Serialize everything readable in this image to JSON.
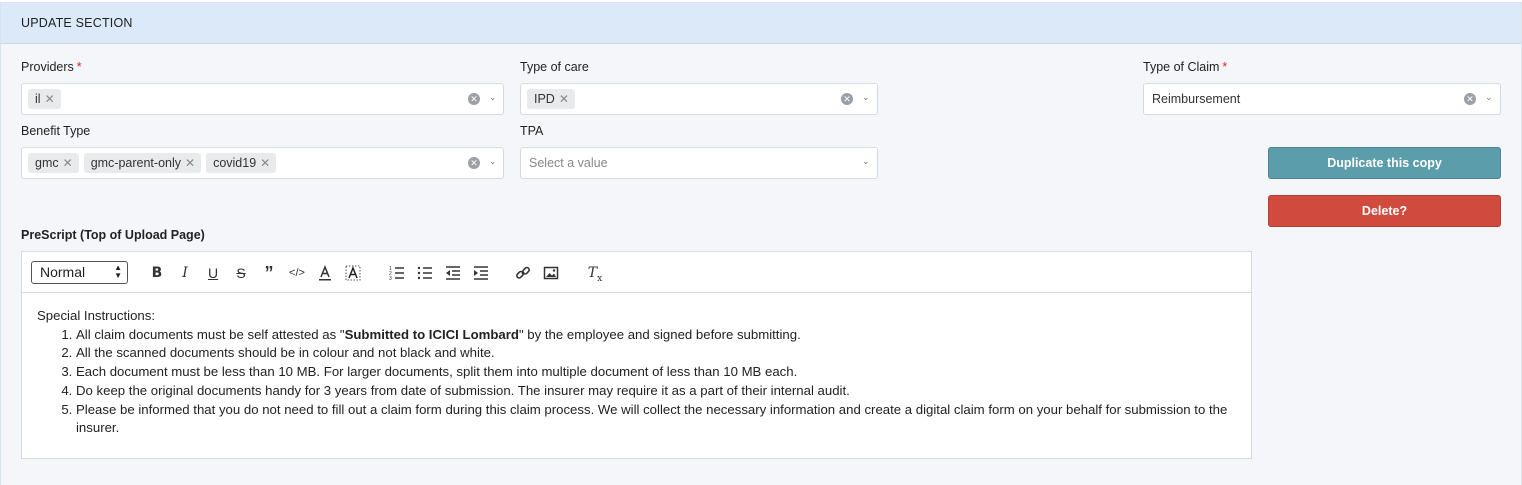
{
  "header": {
    "title": "UPDATE SECTION"
  },
  "fields": {
    "providers": {
      "label": "Providers",
      "required": "*",
      "chips": [
        "il"
      ]
    },
    "type_of_care": {
      "label": "Type of care",
      "chips": [
        "IPD"
      ]
    },
    "type_of_claim": {
      "label": "Type of Claim",
      "required": "*",
      "value": "Reimbursement"
    },
    "benefit_type": {
      "label": "Benefit Type",
      "chips": [
        "gmc",
        "gmc-parent-only",
        "covid19"
      ]
    },
    "tpa": {
      "label": "TPA",
      "placeholder": "Select a value"
    }
  },
  "buttons": {
    "duplicate": "Duplicate this copy",
    "delete": "Delete?"
  },
  "prescript": {
    "label": "PreScript (Top of Upload Page)",
    "format": "Normal",
    "intro": "Special Instructions:",
    "item1_pre": "All claim documents must be self attested as \"",
    "item1_bold": "Submitted to ICICI Lombard",
    "item1_post": "\" by the employee and signed before submitting.",
    "item2": "All the scanned documents should be in colour and not black and white.",
    "item3": "Each document must be less than 10 MB. For larger documents, split them into multiple document of less than 10 MB each.",
    "item4": "Do keep the original documents handy for 3 years from date of submission. The insurer may require it as a part of their internal audit.",
    "item5": "Please be informed that you do not need to fill out a claim form during this claim process. We will collect the necessary information and create a digital claim form on your behalf for submission to the insurer."
  },
  "icons": {
    "clear": "clear-icon",
    "chevron": "chevron-down-icon",
    "chip_remove": "times-icon"
  }
}
